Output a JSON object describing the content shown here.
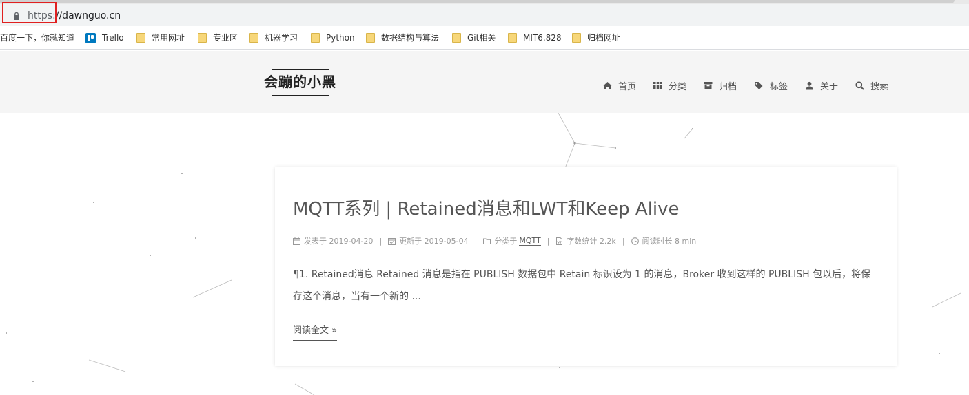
{
  "browser": {
    "url_scheme": "https:",
    "url_rest": "//dawnguo.cn"
  },
  "bookmarks": [
    {
      "label": "百度一下，你就知道",
      "icon": "none"
    },
    {
      "label": "Trello",
      "icon": "trello-icon"
    },
    {
      "label": "常用网址",
      "icon": "folder-icon"
    },
    {
      "label": "专业区",
      "icon": "folder-icon"
    },
    {
      "label": "机器学习",
      "icon": "folder-icon"
    },
    {
      "label": "Python",
      "icon": "folder-icon"
    },
    {
      "label": "数据结构与算法",
      "icon": "folder-icon"
    },
    {
      "label": "Git相关",
      "icon": "folder-icon"
    },
    {
      "label": "MIT6.828",
      "icon": "folder-icon"
    },
    {
      "label": "归档网址",
      "icon": "folder-icon"
    }
  ],
  "site": {
    "brand": "会蹦的小黑",
    "menu": [
      {
        "label": "首页",
        "icon": "home-icon"
      },
      {
        "label": "分类",
        "icon": "grid-icon"
      },
      {
        "label": "归档",
        "icon": "archive-icon"
      },
      {
        "label": "标签",
        "icon": "tags-icon"
      },
      {
        "label": "关于",
        "icon": "user-icon"
      },
      {
        "label": "搜索",
        "icon": "search-icon"
      }
    ]
  },
  "post": {
    "title": "MQTT系列 | Retained消息和LWT和Keep Alive",
    "meta": {
      "posted_label": "发表于",
      "posted_date": "2019-04-20",
      "updated_label": "更新于",
      "updated_date": "2019-05-04",
      "category_label": "分类于",
      "category": "MQTT",
      "wordcount_label": "字数统计",
      "wordcount": "2.2k",
      "readtime_label": "阅读时长",
      "readtime": "8 min",
      "separator": "|"
    },
    "excerpt": "¶1. Retained消息 Retained 消息是指在 PUBLISH 数据包中 Retain 标识设为 1 的消息，Broker 收到这样的 PUBLISH 包以后，将保存这个消息，当有一个新的 ...",
    "read_more": "阅读全文 »"
  },
  "colors": {
    "highlight": "#e02020",
    "header_bg": "#f5f5f5",
    "text": "#555555",
    "meta": "#999999"
  }
}
